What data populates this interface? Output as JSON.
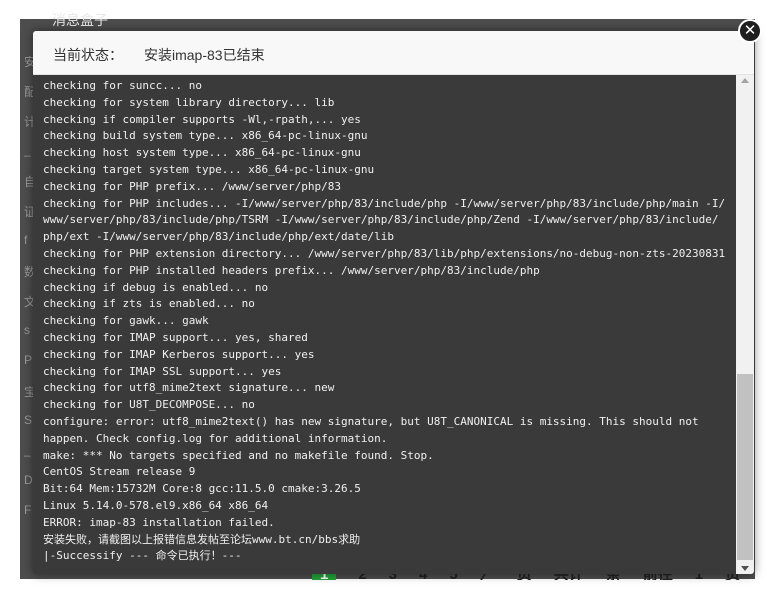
{
  "background": {
    "title": "消息盒子",
    "side_letters": [
      "安",
      "配",
      "计",
      "_",
      "自",
      "证",
      "f",
      "数",
      "文",
      "s",
      "P",
      "宝",
      "S",
      "_",
      "D",
      "F"
    ],
    "pagination": [
      "1",
      "2",
      "3",
      "4",
      "5",
      "〉",
      "页",
      "共计",
      "条",
      "前往",
      "1",
      "页"
    ]
  },
  "modal": {
    "status_label": "当前状态：",
    "status_value": "安装imap-83已结束",
    "close_icon": "close-icon",
    "log_lines": [
      "checking for suncc... no",
      "checking for system library directory... lib",
      "checking if compiler supports -Wl,-rpath,... yes",
      "checking build system type... x86_64-pc-linux-gnu",
      "checking host system type... x86_64-pc-linux-gnu",
      "checking target system type... x86_64-pc-linux-gnu",
      "checking for PHP prefix... /www/server/php/83",
      "checking for PHP includes... -I/www/server/php/83/include/php -I/www/server/php/83/include/php/main -I/",
      "www/server/php/83/include/php/TSRM -I/www/server/php/83/include/php/Zend -I/www/server/php/83/include/",
      "php/ext -I/www/server/php/83/include/php/ext/date/lib",
      "checking for PHP extension directory... /www/server/php/83/lib/php/extensions/no-debug-non-zts-20230831",
      "checking for PHP installed headers prefix... /www/server/php/83/include/php",
      "checking if debug is enabled... no",
      "checking if zts is enabled... no",
      "checking for gawk... gawk",
      "checking for IMAP support... yes, shared",
      "checking for IMAP Kerberos support... yes",
      "checking for IMAP SSL support... yes",
      "checking for utf8_mime2text signature... new",
      "checking for U8T_DECOMPOSE... no",
      "configure: error: utf8_mime2text() has new signature, but U8T_CANONICAL is missing. This should not",
      "happen. Check config.log for additional information.",
      "make: *** No targets specified and no makefile found. Stop.",
      "CentOS Stream release 9",
      "Bit:64 Mem:15732M Core:8 gcc:11.5.0 cmake:3.26.5",
      "Linux 5.14.0-578.el9.x86_64 x86_64",
      "ERROR: imap-83 installation failed.",
      "安装失败，请截图以上报错信息发帖至论坛www.bt.cn/bbs求助",
      "|-Successify --- 命令已执行！---"
    ],
    "scroll_position": 0.92
  }
}
